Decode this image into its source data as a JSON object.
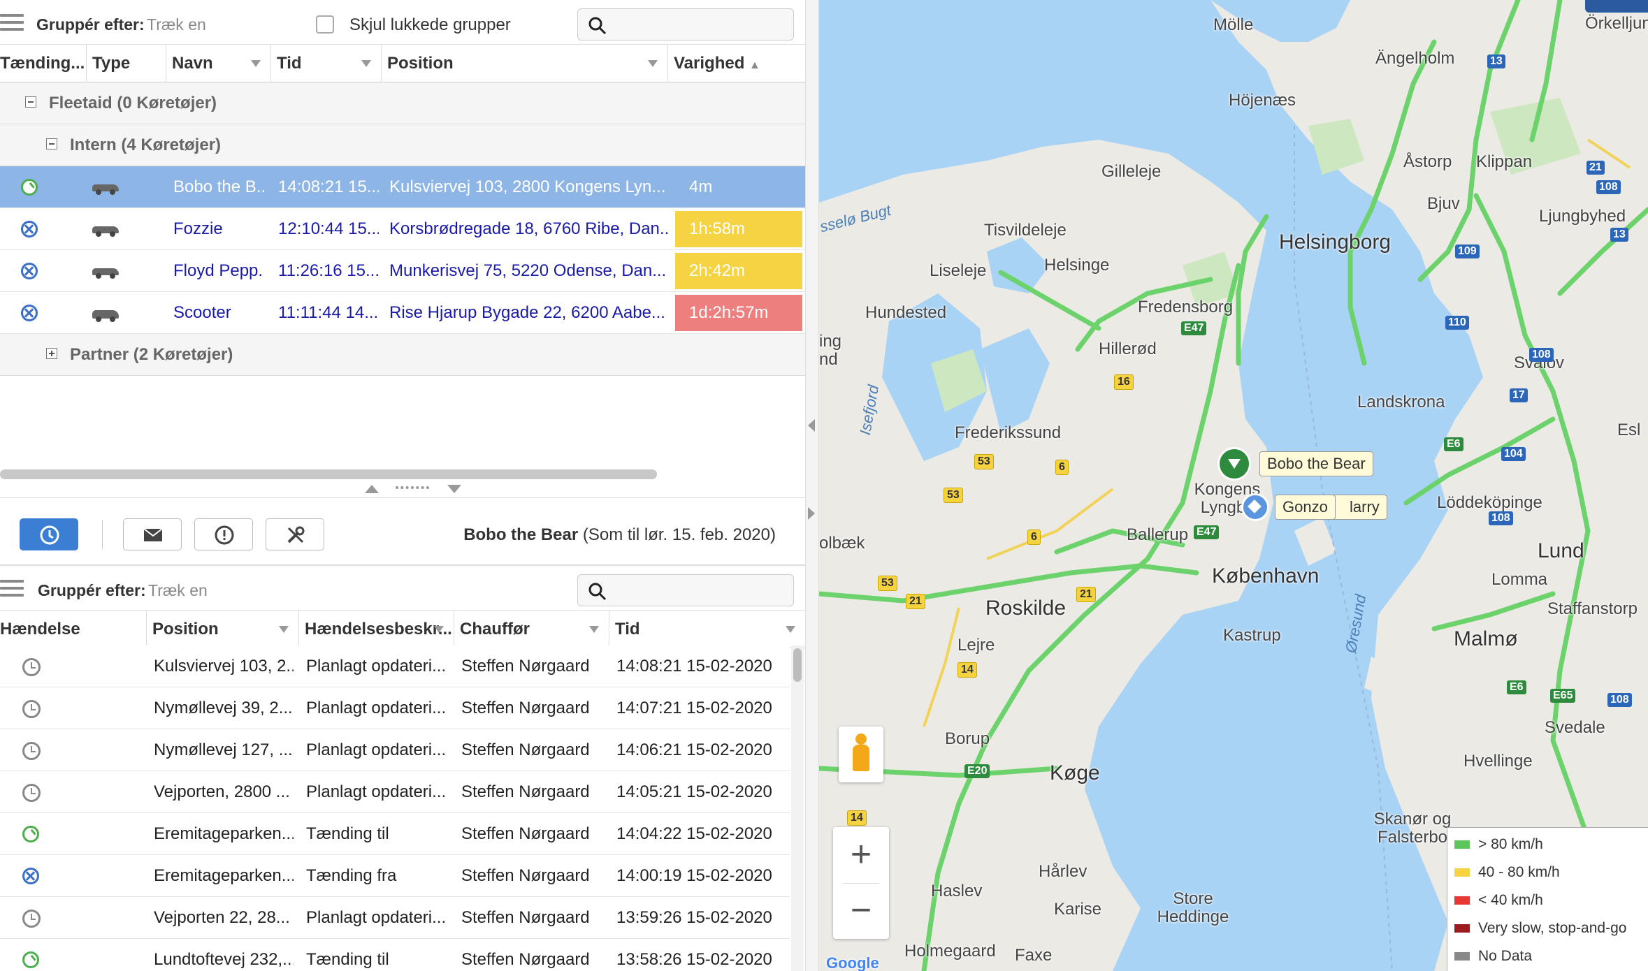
{
  "top_panel": {
    "group_by_label": "Gruppér efter:",
    "group_by_placeholder": "Træk en",
    "hide_closed_label": "Skjul lukkede grupper",
    "search_value": ""
  },
  "vehicle_table": {
    "columns": [
      "Tænding...",
      "Type",
      "Navn",
      "Tid",
      "Position",
      "Varighed"
    ],
    "groups": [
      {
        "label": "Fleetaid (0 Køretøjer)"
      },
      {
        "label": "Intern (4 Køretøjer)"
      },
      {
        "label": "Partner (2 Køretøjer)"
      }
    ],
    "rows": [
      {
        "ignition": "on",
        "name": "Bobo the B...",
        "time": "14:08:21 15...",
        "position": "Kulsviervej 103, 2800 Kongens Lyn...",
        "duration": "4m",
        "duration_color": "",
        "selected": true
      },
      {
        "ignition": "off",
        "name": "Fozzie",
        "time": "12:10:44 15...",
        "position": "Korsbrødregade 18, 6760 Ribe, Dan...",
        "duration": "1h:58m",
        "duration_color": "#f5d342",
        "selected": false
      },
      {
        "ignition": "off",
        "name": "Floyd Pepp...",
        "time": "11:26:16 15...",
        "position": "Munkerisvej 75, 5220 Odense, Dan...",
        "duration": "2h:42m",
        "duration_color": "#f5d342",
        "selected": false
      },
      {
        "ignition": "off",
        "name": "Scooter",
        "time": "11:11:44 14...",
        "position": "Rise Hjarup Bygade 22, 6200 Aabe...",
        "duration": "1d:2h:57m",
        "duration_color": "#ee7f7f",
        "selected": false
      }
    ]
  },
  "action_bar": {
    "buttons": [
      "history-icon",
      "mail-icon",
      "alert-icon",
      "tools-icon"
    ],
    "vehicle_name": "Bobo the Bear",
    "vehicle_info": " (Som til lør. 15. feb. 2020)"
  },
  "bottom_panel": {
    "group_by_label": "Gruppér efter:",
    "group_by_placeholder": "Træk en"
  },
  "event_table": {
    "columns": [
      "Hændelse",
      "Position",
      "Hændelsesbeskr...",
      "Chauffør",
      "Tid"
    ],
    "rows": [
      {
        "icon": "clock",
        "position": "Kulsviervej 103, 2...",
        "description": "Planlagt opdateri...",
        "driver": "Steffen Nørgaard",
        "time": "14:08:21 15-02-2020"
      },
      {
        "icon": "clock",
        "position": "Nymøllevej 39, 2...",
        "description": "Planlagt opdateri...",
        "driver": "Steffen Nørgaard",
        "time": "14:07:21 15-02-2020"
      },
      {
        "icon": "clock",
        "position": "Nymøllevej 127, ...",
        "description": "Planlagt opdateri...",
        "driver": "Steffen Nørgaard",
        "time": "14:06:21 15-02-2020"
      },
      {
        "icon": "clock",
        "position": "Vejporten, 2800 ...",
        "description": "Planlagt opdateri...",
        "driver": "Steffen Nørgaard",
        "time": "14:05:21 15-02-2020"
      },
      {
        "icon": "ignition-on",
        "position": "Eremitageparken...",
        "description": "Tænding til",
        "driver": "Steffen Nørgaard",
        "time": "14:04:22 15-02-2020"
      },
      {
        "icon": "ignition-off",
        "position": "Eremitageparken...",
        "description": "Tænding fra",
        "driver": "Steffen Nørgaard",
        "time": "14:00:19 15-02-2020"
      },
      {
        "icon": "clock",
        "position": "Vejporten 22, 28...",
        "description": "Planlagt opdateri...",
        "driver": "Steffen Nørgaard",
        "time": "13:59:26 15-02-2020"
      },
      {
        "icon": "ignition-on",
        "position": "Lundtoftevej 232,...",
        "description": "Tænding til",
        "driver": "Steffen Nørgaard",
        "time": "13:58:26 15-02-2020"
      }
    ]
  },
  "map": {
    "places": [
      "Mölle",
      "Örkelljung",
      "Ängelholm",
      "Höjenæs",
      "Åstorp",
      "Klippan",
      "Bjuv",
      "Ljungbyhed",
      "Gilleleje",
      "Tisvildeleje",
      "Helsingborg",
      "Liseleje",
      "Helsinge",
      "Hundested",
      "Fredensborg",
      "Hillerød",
      "Svalöv",
      "Landskrona",
      "Frederikssund",
      "Kongens Lyngby",
      "Löddeköpinge",
      "Ballerup",
      "København",
      "Lund",
      "Lomma",
      "Staffanstorp",
      "Roskilde",
      "Kastrup",
      "Malmø",
      "Lejre",
      "Borup",
      "Køge",
      "Hvellinge",
      "Svedale",
      "Skanør og Falsterbo",
      "Hårlev",
      "Haslev",
      "Karise",
      "Store Heddinge",
      "Holmegaard",
      "Faxe",
      "Esl",
      "olbæk",
      "ing nd"
    ],
    "water_labels": [
      "sselø Bugt",
      "Isefjord",
      "Øresund"
    ],
    "road_shields": [
      "13",
      "21",
      "108",
      "13",
      "109",
      "E47",
      "110",
      "108",
      "16",
      "17",
      "6",
      "E6",
      "104",
      "53",
      "53",
      "6",
      "108",
      "E47",
      "53",
      "21",
      "21",
      "14",
      "E6",
      "E65",
      "108",
      "E20",
      "14"
    ],
    "markers": [
      {
        "label": "Bobo the Bear"
      },
      {
        "label": "Gonzo"
      },
      {
        "label": "larry"
      }
    ],
    "legend": [
      {
        "label": "> 80 km/h",
        "color": "#5cc55c"
      },
      {
        "label": "40 - 80 km/h",
        "color": "#f5d342"
      },
      {
        "label": "< 40 km/h",
        "color": "#e53935"
      },
      {
        "label": "Very slow, stop-and-go",
        "color": "#9b1c1c"
      },
      {
        "label": "No Data",
        "color": "#888888"
      }
    ],
    "zoom_in": "+",
    "zoom_out": "−",
    "attribution": "Google"
  }
}
